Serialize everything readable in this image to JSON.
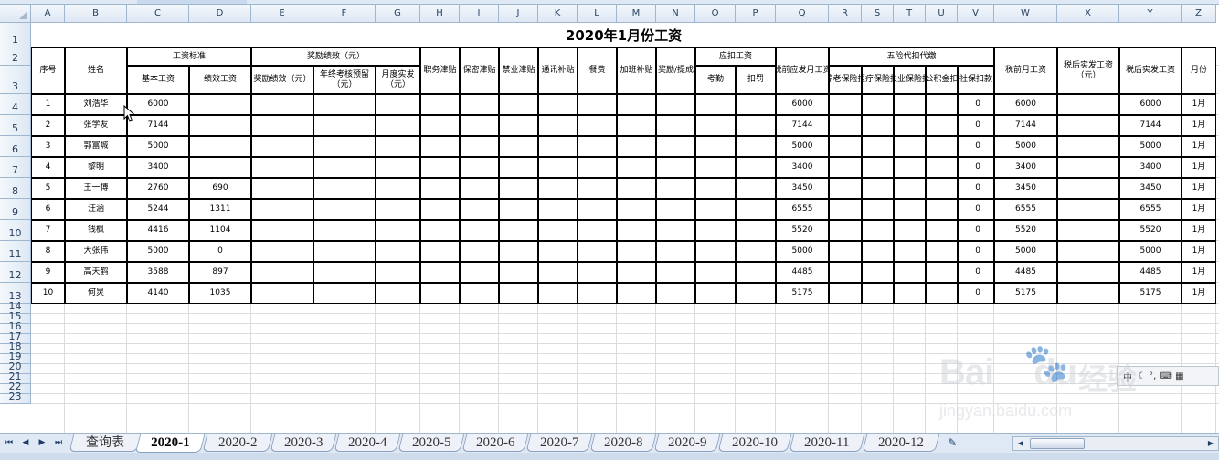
{
  "columns": [
    "A",
    "B",
    "C",
    "D",
    "E",
    "F",
    "G",
    "H",
    "I",
    "J",
    "K",
    "L",
    "M",
    "N",
    "O",
    "P",
    "Q",
    "R",
    "S",
    "T",
    "U",
    "V",
    "W",
    "X",
    "Y",
    "Z"
  ],
  "rows": [
    "1",
    "2",
    "3",
    "4",
    "5",
    "6",
    "7",
    "8",
    "9",
    "10",
    "11",
    "12",
    "13",
    "14",
    "15",
    "16",
    "17",
    "18",
    "19",
    "20",
    "21",
    "22",
    "23"
  ],
  "title": "2020年1月份工资",
  "headers": {
    "seq": "序号",
    "name": "姓名",
    "wage_standard": "工资标准",
    "base_wage": "基本工资",
    "perf_wage": "绩效工资",
    "bonus_group": "奖励绩效（元）",
    "bonus_perf": "奖励绩效（元）",
    "year_end_reserve": "年终考核预留（元）",
    "monthly_actual": "月度实发（元）",
    "duty_allowance": "职务津贴",
    "secrecy_allowance": "保密津贴",
    "professional_allowance": "禁业津贴",
    "comm_allowance": "通讯补贴",
    "meal": "餐费",
    "overtime": "加班补贴",
    "reward_commission": "奖励/提成",
    "deduct_group": "应扣工资",
    "attendance": "考勤",
    "penalty": "扣罚",
    "pre_tax_payable": "税前应发月工资",
    "insurance_group": "五险代扣代缴",
    "pension": "养老保险扣",
    "medical": "医疗保险扣",
    "unemployment": "失业保险扣",
    "housing": "公积金扣",
    "social_total": "社保扣款",
    "pre_tax_monthly": "税前月工资",
    "after_tax": "税后实发工资（元）",
    "after_tax_actual": "税后实发工资",
    "month": "月份"
  },
  "employees": [
    {
      "seq": "1",
      "name": "刘浩华",
      "base": "6000",
      "perf": "",
      "pretax_payable": "6000",
      "social": "0",
      "pretax_monthly": "6000",
      "after_tax_actual": "6000",
      "month": "1月"
    },
    {
      "seq": "2",
      "name": "张学友",
      "base": "7144",
      "perf": "",
      "pretax_payable": "7144",
      "social": "0",
      "pretax_monthly": "7144",
      "after_tax_actual": "7144",
      "month": "1月"
    },
    {
      "seq": "3",
      "name": "郭富城",
      "base": "5000",
      "perf": "",
      "pretax_payable": "5000",
      "social": "0",
      "pretax_monthly": "5000",
      "after_tax_actual": "5000",
      "month": "1月"
    },
    {
      "seq": "4",
      "name": "黎明",
      "base": "3400",
      "perf": "",
      "pretax_payable": "3400",
      "social": "0",
      "pretax_monthly": "3400",
      "after_tax_actual": "3400",
      "month": "1月"
    },
    {
      "seq": "5",
      "name": "王一博",
      "base": "2760",
      "perf": "690",
      "pretax_payable": "3450",
      "social": "0",
      "pretax_monthly": "3450",
      "after_tax_actual": "3450",
      "month": "1月"
    },
    {
      "seq": "6",
      "name": "汪涵",
      "base": "5244",
      "perf": "1311",
      "pretax_payable": "6555",
      "social": "0",
      "pretax_monthly": "6555",
      "after_tax_actual": "6555",
      "month": "1月"
    },
    {
      "seq": "7",
      "name": "钱枫",
      "base": "4416",
      "perf": "1104",
      "pretax_payable": "5520",
      "social": "0",
      "pretax_monthly": "5520",
      "after_tax_actual": "5520",
      "month": "1月"
    },
    {
      "seq": "8",
      "name": "大张伟",
      "base": "5000",
      "perf": "0",
      "pretax_payable": "5000",
      "social": "0",
      "pretax_monthly": "5000",
      "after_tax_actual": "5000",
      "month": "1月"
    },
    {
      "seq": "9",
      "name": "高天鹤",
      "base": "3588",
      "perf": "897",
      "pretax_payable": "4485",
      "social": "0",
      "pretax_monthly": "4485",
      "after_tax_actual": "4485",
      "month": "1月"
    },
    {
      "seq": "10",
      "name": "何炅",
      "base": "4140",
      "perf": "1035",
      "pretax_payable": "5175",
      "social": "0",
      "pretax_monthly": "5175",
      "after_tax_actual": "5175",
      "month": "1月"
    }
  ],
  "sheet_tabs": [
    "查询表",
    "2020-1",
    "2020-2",
    "2020-3",
    "2020-4",
    "2020-5",
    "2020-6",
    "2020-7",
    "2020-8",
    "2020-9",
    "2020-10",
    "2020-11",
    "2020-12"
  ],
  "active_tab": "2020-1",
  "ime_bar": {
    "label": "中",
    "glyphs": "☾ °, ⌨ ▦"
  },
  "watermark": {
    "logo": "Bai",
    "logo_tail": "du",
    "paw": "🐾",
    "cn": "经验",
    "url": "jingyan.baidu.com"
  },
  "colors": {
    "grid": "#dadcdd",
    "header_bg": "#dde7f3",
    "header_border": "#9eb6ce",
    "tab_bar": "#dfe8f5"
  }
}
